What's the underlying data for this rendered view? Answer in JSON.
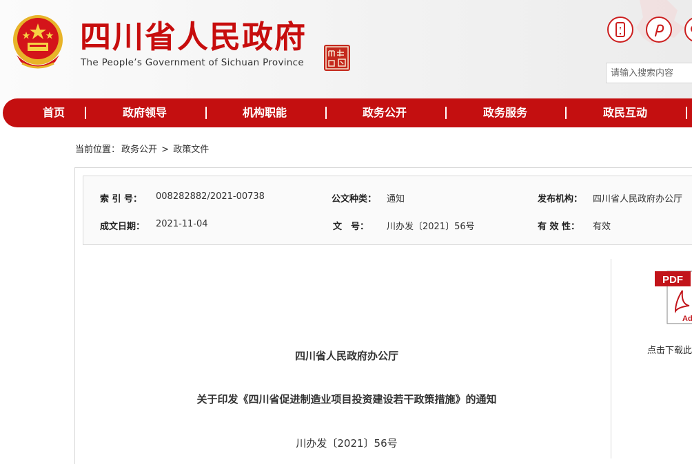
{
  "header": {
    "title": "四川省人民政府",
    "subtitle": "The People’s Government of Sichuan Province",
    "seal_text": "四川中國",
    "icons": [
      "mobile-icon",
      "weibo-icon",
      "wechat-icon"
    ],
    "search": {
      "placeholder": "请输入搜索内容"
    }
  },
  "nav": {
    "items": [
      "首页",
      "政府领导",
      "机构职能",
      "政务公开",
      "政务服务",
      "政民互动"
    ],
    "separator": "|"
  },
  "breadcrumb": {
    "prefix": "当前位置：",
    "level1": "政务公开",
    "sep": ">",
    "level2": "政策文件"
  },
  "meta": {
    "index_label": "索 引 号：",
    "index_value": "008282882/2021-00738",
    "type_label": "公文种类：",
    "type_value": "通知",
    "org_label": "发布机构：",
    "org_value": "四川省人民政府办公厅",
    "date_label": "成文日期：",
    "date_value": "2021-11-04",
    "docno_label": "文　号：",
    "docno_value": "川办发〔2021〕56号",
    "valid_label": "有 效 性：",
    "valid_value": "有效"
  },
  "sidebar": {
    "pdf_badge": "PDF",
    "pdf_mark": "Ad",
    "download_text": "点击下载此"
  },
  "document": {
    "issuer": "四川省人民政府办公厅",
    "title": "关于印发《四川省促进制造业项目投资建设若干政策措施》的通知",
    "number": "川办发〔2021〕56号"
  },
  "colors": {
    "brand_red": "#c40f10",
    "title_red": "#c70d0d",
    "border": "#d8d8d8"
  }
}
